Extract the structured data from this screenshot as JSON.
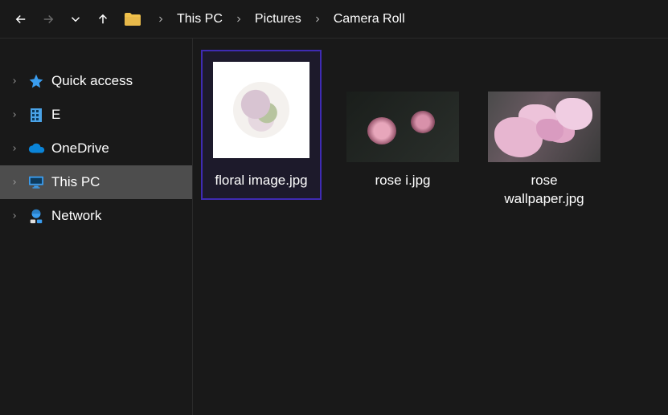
{
  "breadcrumb": {
    "items": [
      {
        "label": "This PC"
      },
      {
        "label": "Pictures"
      },
      {
        "label": "Camera Roll"
      }
    ]
  },
  "sidebar": {
    "items": [
      {
        "label": "Quick access",
        "icon": "star-icon",
        "selected": false
      },
      {
        "label": "E",
        "icon": "building-icon",
        "selected": false
      },
      {
        "label": "OneDrive",
        "icon": "cloud-icon",
        "selected": false
      },
      {
        "label": "This PC",
        "icon": "monitor-icon",
        "selected": true
      },
      {
        "label": "Network",
        "icon": "network-icon",
        "selected": false
      }
    ]
  },
  "files": {
    "items": [
      {
        "label": "floral image.jpg",
        "selected": true
      },
      {
        "label": "rose i.jpg",
        "selected": false
      },
      {
        "label": "rose wallpaper.jpg",
        "selected": false
      }
    ]
  }
}
